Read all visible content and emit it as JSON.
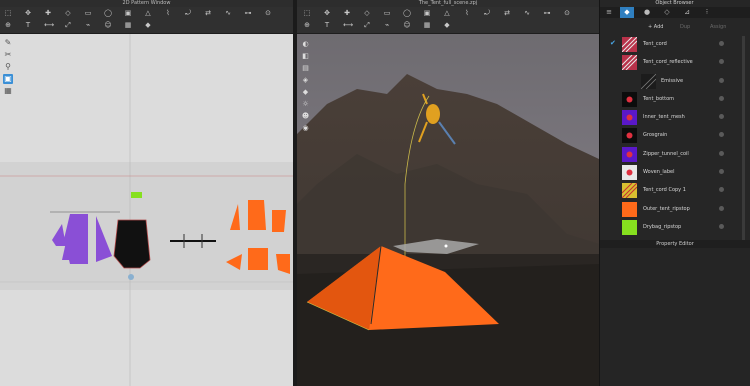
{
  "left_window": {
    "title": "2D Pattern Window",
    "toolbar_icons": [
      "select-icon",
      "transform-icon",
      "edit-point-icon",
      "polygon-icon",
      "rectangle-icon",
      "ellipse-icon",
      "internal-shape-icon",
      "dart-icon",
      "seam-icon",
      "fold-icon",
      "sewing-icon",
      "free-sewing-icon",
      "segment-sewing-icon",
      "pin-icon",
      "tack-icon",
      "text-icon",
      "measure-icon",
      "grade-icon",
      "trace-icon",
      "avatar-icon",
      "layout-icon",
      "fabric-icon"
    ],
    "vertical_tools": [
      "pen-icon",
      "scissors-icon",
      "zoom-icon",
      "display-icon",
      "grid-icon"
    ]
  },
  "center_window": {
    "title": "The_Tent_full_scene.zpj",
    "toolbar_icons": [
      "select-move-icon",
      "move-icon",
      "tack-icon",
      "pin-icon",
      "fold-icon",
      "grid-icon",
      "shape-icon",
      "fabric-icon",
      "texture-icon",
      "strap-icon",
      "zipper-icon",
      "button-icon",
      "topstitch-icon",
      "puckering-icon",
      "measure-icon",
      "avatar-icon",
      "simulate-icon",
      "record-icon",
      "camera-icon",
      "light-icon",
      "render-icon",
      "settings-icon"
    ],
    "vertical_tools": [
      "display-avatar-icon",
      "display-garment-icon",
      "display-pattern-icon",
      "display-texture-icon",
      "display-fabric-icon",
      "display-light-icon",
      "display-avatar-skin-icon",
      "display-environment-icon"
    ]
  },
  "object_browser": {
    "title": "Object Browser",
    "tabs": [
      "menu-icon",
      "fabric-icon",
      "avatar-icon",
      "trims-icon",
      "wand-icon",
      "dots-icon"
    ],
    "add_label": "+ Add",
    "action1": "Dup",
    "action2": "Assign",
    "materials": [
      {
        "label": "Tent_cord",
        "checked": true,
        "thumb": "cord-pattern"
      },
      {
        "label": "Tent_cord_reflective",
        "checked": false,
        "thumb": "cord-pattern"
      },
      {
        "label": "Emissive",
        "checked": false,
        "thumb": "dark-dots",
        "sub": true
      },
      {
        "label": "Tent_bottom",
        "checked": false,
        "thumb": "black-logo"
      },
      {
        "label": "Inner_tent_mesh",
        "checked": false,
        "thumb": "purple-logo"
      },
      {
        "label": "Grosgrain",
        "checked": false,
        "thumb": "black-logo"
      },
      {
        "label": "Zipper_tunnel_coil",
        "checked": false,
        "thumb": "purple-logo"
      },
      {
        "label": "Woven_label",
        "checked": false,
        "thumb": "white-pattern"
      },
      {
        "label": "Tent_cord Copy 1",
        "checked": false,
        "thumb": "yellow-pattern"
      },
      {
        "label": "Outer_tent_ripstop",
        "checked": false,
        "thumb": "orange"
      },
      {
        "label": "Drybag_ripstop",
        "checked": false,
        "thumb": "green"
      }
    ],
    "property_editor": "Property Editor"
  },
  "colors": {
    "accent": "#2f7fc0",
    "tent_orange": "#ff6a1a",
    "pattern_purple": "#8a4fd6",
    "pattern_green": "#86e01f"
  }
}
